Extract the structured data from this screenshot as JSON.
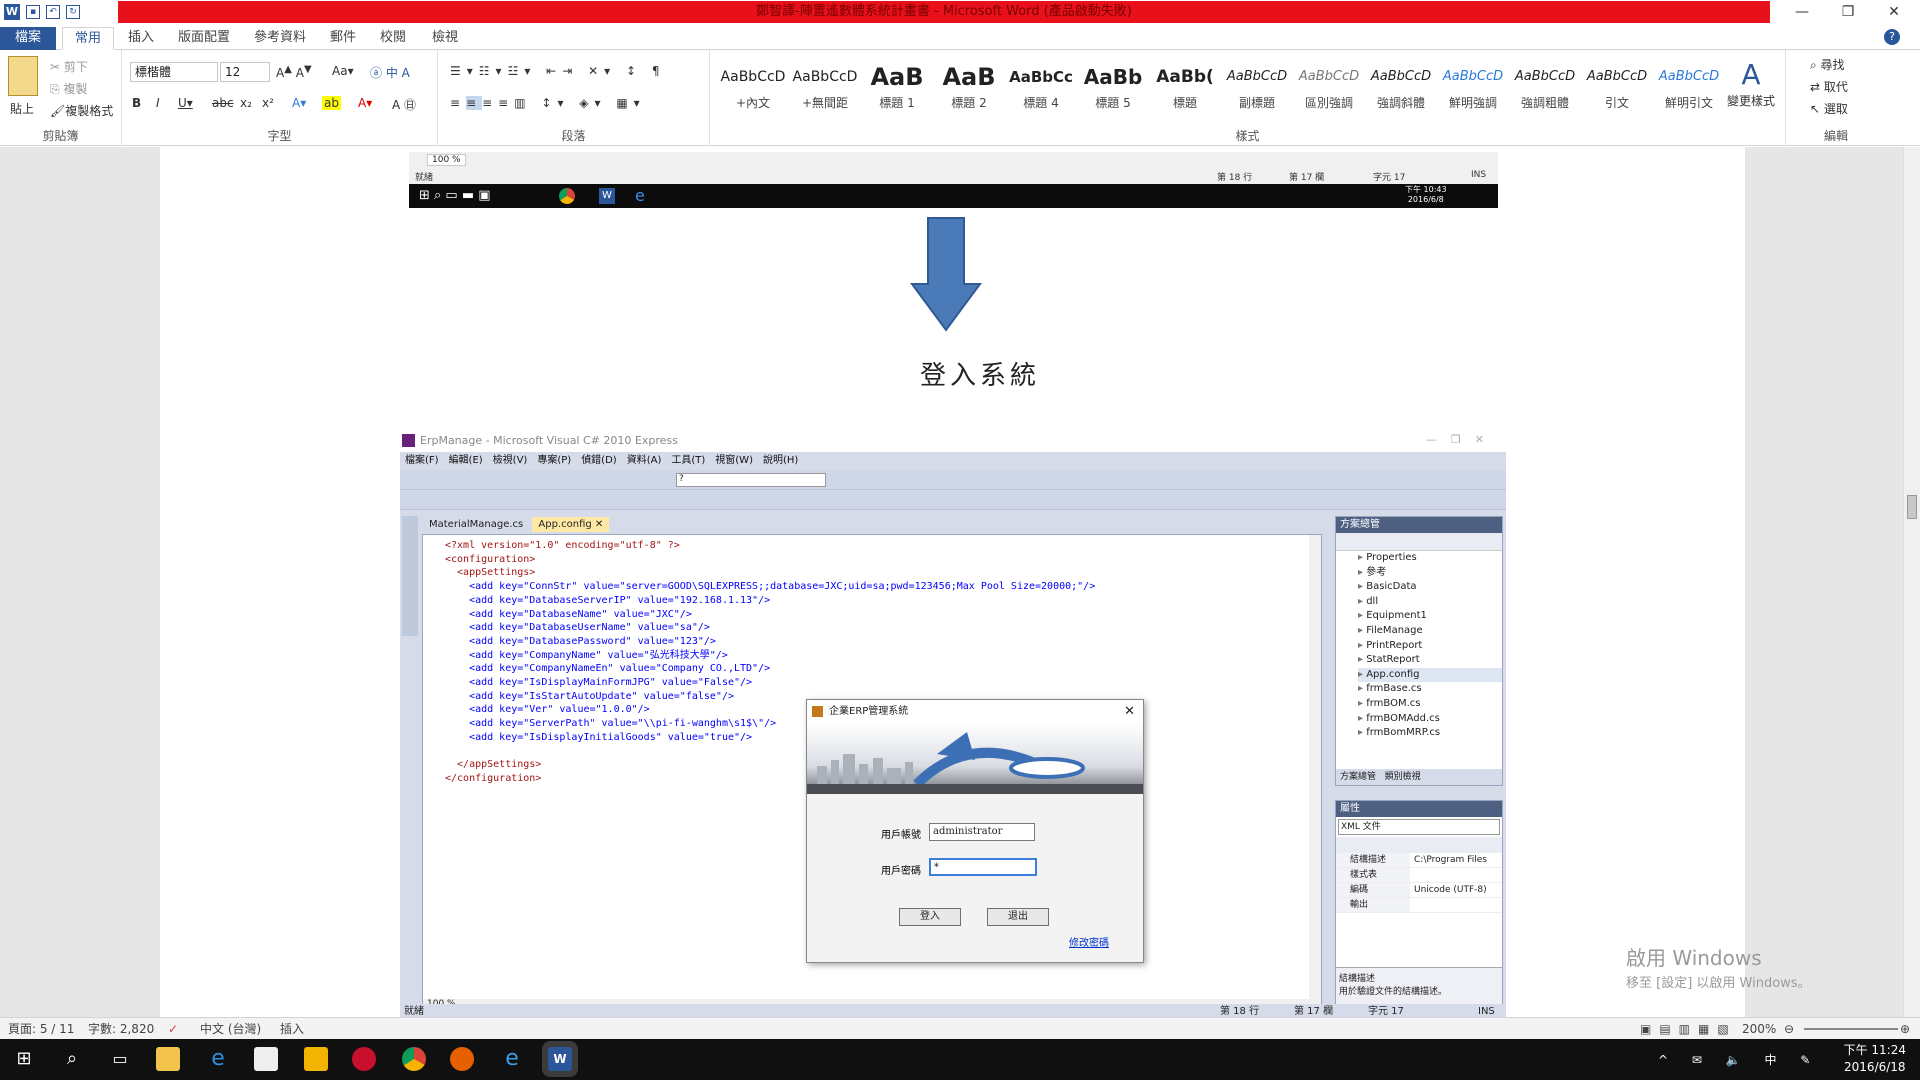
{
  "window": {
    "title": "鄭智譯-陣置遙數體系統計畫書 - Microsoft Word (產品啟動失敗)"
  },
  "ribbon_tabs": [
    "檔案",
    "常用",
    "插入",
    "版面配置",
    "參考資料",
    "郵件",
    "校閱",
    "檢視"
  ],
  "ribbon": {
    "clipboard": {
      "label": "剪貼簿",
      "paste": "貼上",
      "cut": "剪下",
      "copy": "複製",
      "format_painter": "複製格式"
    },
    "font": {
      "label": "字型",
      "font_name": "標楷體",
      "font_size": "12"
    },
    "paragraph": {
      "label": "段落"
    },
    "styles": {
      "label": "樣式",
      "items": [
        {
          "preview": "AaBbCcD",
          "name": "+內文"
        },
        {
          "preview": "AaBbCcD",
          "name": "+無間距"
        },
        {
          "preview": "AaB",
          "name": "標題 1"
        },
        {
          "preview": "AaB",
          "name": "標題 2"
        },
        {
          "preview": "AaBbCc",
          "name": "標題 4"
        },
        {
          "preview": "AaBb",
          "name": "標題 5"
        },
        {
          "preview": "AaBb(",
          "name": "標題"
        },
        {
          "preview": "AaBbCcD",
          "name": "副標題"
        },
        {
          "preview": "AaBbCcD",
          "name": "區別強調"
        },
        {
          "preview": "AaBbCcD",
          "name": "強調斜體"
        },
        {
          "preview": "AaBbCcD",
          "name": "鮮明強調"
        },
        {
          "preview": "AaBbCcD",
          "name": "強調粗體"
        },
        {
          "preview": "AaBbCcD",
          "name": "引文"
        },
        {
          "preview": "AaBbCcD",
          "name": "鮮明引文"
        }
      ],
      "change_styles": "變更樣式"
    },
    "editing": {
      "label": "編輯",
      "find": "尋找",
      "replace": "取代",
      "select": "選取"
    }
  },
  "top_screenshot": {
    "zoom": "100 %",
    "status": "就緒",
    "line": "第 18 行",
    "col": "第 17 欄",
    "char": "字元 17",
    "mode": "INS",
    "time": "下午 10:43",
    "date": "2016/6/8"
  },
  "heading": "登入系統",
  "vs": {
    "title": "ErpManage - Microsoft Visual C# 2010 Express",
    "menu": [
      "檔案(F)",
      "編輯(E)",
      "檢視(V)",
      "專案(P)",
      "偵錯(D)",
      "資料(A)",
      "工具(T)",
      "視窗(W)",
      "說明(H)"
    ],
    "tabs": [
      "MaterialManage.cs",
      "App.config"
    ],
    "code": [
      "<?xml version=\"1.0\" encoding=\"utf-8\" ?>",
      "<configuration>",
      "  <appSettings>",
      "    <add key=\"ConnStr\" value=\"server=GOOD\\SQLEXPRESS;;database=JXC;uid=sa;pwd=123456;Max Pool Size=20000;\"/>",
      "    <add key=\"DatabaseServerIP\" value=\"192.168.1.13\"/>",
      "    <add key=\"DatabaseName\" value=\"JXC\"/>",
      "    <add key=\"DatabaseUserName\" value=\"sa\"/>",
      "    <add key=\"DatabasePassword\" value=\"123\"/>",
      "    <add key=\"CompanyName\" value=\"弘光科技大學\"/>",
      "    <add key=\"CompanyNameEn\" value=\"Company CO.,LTD\"/>",
      "    <add key=\"IsDisplayMainFormJPG\" value=\"False\"/>",
      "    <add key=\"IsStartAutoUpdate\" value=\"false\"/>",
      "    <add key=\"Ver\" value=\"1.0.0\"/>",
      "    <add key=\"ServerPath\" value=\"\\\\pi-fi-wanghm\\s1$\\\"/>",
      "    <add key=\"IsDisplayInitialGoods\" value=\"true\"/>",
      "",
      "  </appSettings>",
      "</configuration>"
    ],
    "solution_title": "方案總管",
    "solution_items": [
      "Properties",
      "參考",
      "BasicData",
      "dll",
      "Equipment1",
      "FileManage",
      "PrintReport",
      "StatReport",
      "App.config",
      "frmBase.cs",
      "frmBOM.cs",
      "frmBOMAdd.cs",
      "frmBomMRP.cs"
    ],
    "solution_tabs": [
      "方案總管",
      "類別檢視"
    ],
    "props_title": "屬性",
    "props_combo": "XML 文件",
    "props": [
      {
        "k": "結構描述",
        "v": "C:\\Program Files"
      },
      {
        "k": "樣式表",
        "v": ""
      },
      {
        "k": "編碼",
        "v": "Unicode (UTF-8)"
      },
      {
        "k": "輸出",
        "v": ""
      }
    ],
    "props_desc_title": "結構描述",
    "props_desc": "用於驗證文件的結構描述。",
    "zoom": "100 %",
    "status": "就緒",
    "line": "第 18 行",
    "col": "第 17 欄",
    "char": "字元 17",
    "mode": "INS"
  },
  "login": {
    "title": "企業ERP管理系統",
    "user_label": "用戶帳號",
    "user_value": "administrator",
    "pwd_label": "用戶密碼",
    "pwd_value": "*",
    "login_btn": "登入",
    "exit_btn": "退出",
    "change_pwd": "修改密碼"
  },
  "status": {
    "page": "頁面: 5 / 11",
    "words": "字數: 2,820",
    "lang": "中文 (台灣)",
    "mode": "插入",
    "zoom": "200%"
  },
  "watermark": {
    "line1": "啟用 Windows",
    "line2": "移至 [設定] 以啟用 Windows。"
  },
  "clock": {
    "time": "下午 11:24",
    "date": "2016/6/18"
  },
  "colors": {
    "word_blue": "#2b579a",
    "title_red": "#e8101a",
    "arrow_blue": "#4a7ab8",
    "vs_blue": "#4d6082"
  }
}
